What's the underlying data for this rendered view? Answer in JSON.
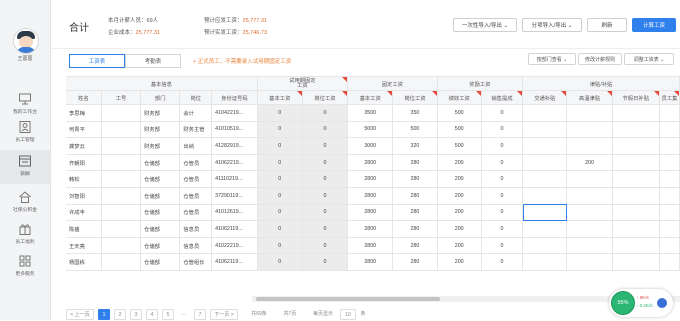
{
  "sidebar": {
    "user_name": "王蓉蓉",
    "items": [
      {
        "label": "我的工作台",
        "icon": "monitor-icon"
      },
      {
        "label": "员工管理",
        "icon": "employee-icon"
      },
      {
        "label": "薪酬",
        "icon": "payroll-icon"
      },
      {
        "label": "社保公积金",
        "icon": "house-icon"
      },
      {
        "label": "员工福利",
        "icon": "gift-icon"
      },
      {
        "label": "更多服务",
        "icon": "grid-icon"
      }
    ]
  },
  "header": {
    "title": "合计",
    "stats": {
      "count_label": "本月计薪人员：",
      "count_value": "69人",
      "cost_label": "企业成本：",
      "cost_value": "25,777.31",
      "plan_label": "预计应发工资：",
      "plan_value": "25,777.31",
      "actual_label": "预计实发工资：",
      "actual_value": "25,746.73"
    },
    "buttons": {
      "import_export": "一次性导入/导出 ⌄",
      "split_import": "分项导入/导出 ⌄",
      "refresh": "刷新",
      "calculate": "计算工资"
    }
  },
  "tabs": {
    "salary": "工资表",
    "attendance": "考勤表"
  },
  "hint": "+ 正式员工，不需要录入试用期固定工资",
  "toolbar": {
    "by_dept": "按部门查看 ⌄",
    "modify_rules": "修改计薪规则",
    "adjust_table": "调整工资表 ⌄"
  },
  "table": {
    "groups": {
      "basic": "基本信息",
      "trial": "试用期固定\n工资",
      "fixed": "固定工资",
      "bonus": "奖励工资",
      "allowance": "津贴/补贴"
    },
    "columns": [
      "姓名",
      "工号",
      "部门",
      "岗位",
      "身份证号码",
      "基本工资",
      "岗位工资",
      "基本工资",
      "岗位工资",
      "绩效工资",
      "销售提成",
      "交通补贴",
      "高温津贴",
      "节假日补贴",
      "员工集"
    ],
    "rows": [
      [
        "李思梅",
        "",
        "财务部",
        "会计",
        "41042219...",
        "0",
        "0",
        "3500",
        "350",
        "500",
        "0",
        "",
        "",
        "",
        ""
      ],
      [
        "何青平",
        "",
        "财务部",
        "财务主管",
        "41010519...",
        "0",
        "0",
        "5000",
        "500",
        "500",
        "0",
        "",
        "",
        "",
        ""
      ],
      [
        "龚梦云",
        "",
        "财务部",
        "出纳",
        "41282919...",
        "0",
        "0",
        "3000",
        "320",
        "500",
        "0",
        "",
        "",
        "",
        ""
      ],
      [
        "齐朝阳",
        "",
        "仓储部",
        "仓管员",
        "41062219...",
        "0",
        "0",
        "2800",
        "280",
        "200",
        "0",
        "",
        "200",
        "",
        ""
      ],
      [
        "韩松",
        "",
        "仓储部",
        "仓管员",
        "41110219...",
        "0",
        "0",
        "2800",
        "280",
        "200",
        "0",
        "",
        "",
        "",
        ""
      ],
      [
        "刘智阳",
        "",
        "仓储部",
        "仓管员",
        "37290119...",
        "0",
        "0",
        "2800",
        "280",
        "200",
        "0",
        "",
        "",
        "",
        ""
      ],
      [
        "许成丰",
        "",
        "仓储部",
        "仓管员",
        "41012619...",
        "0",
        "0",
        "2800",
        "280",
        "200",
        "0",
        "",
        "",
        "",
        ""
      ],
      [
        "陈盛",
        "",
        "仓储部",
        "信息员",
        "41062119...",
        "0",
        "0",
        "2800",
        "280",
        "200",
        "0",
        "",
        "",
        "",
        ""
      ],
      [
        "王天亮",
        "",
        "仓储部",
        "信息员",
        "41022219...",
        "0",
        "0",
        "2800",
        "280",
        "200",
        "0",
        "",
        "",
        "",
        ""
      ],
      [
        "杨国栋",
        "",
        "仓储部",
        "仓管组长",
        "41062119...",
        "0",
        "0",
        "2800",
        "280",
        "200",
        "0",
        "",
        "",
        "",
        ""
      ]
    ]
  },
  "pager": {
    "prev": "< 上一页",
    "pages": [
      "1",
      "2",
      "3",
      "4",
      "5",
      "...",
      "7"
    ],
    "next": "下一页 >",
    "total": "共69条",
    "pages_total": "共7页",
    "per_page": "每页显示",
    "size": "10",
    "size2": "条"
  },
  "widget": {
    "percent": "55%",
    "up": "↑ 8K/s",
    "down": "↓ 0.2K/s"
  },
  "colors": {
    "accent": "#2f80ed",
    "highlight": "#e06a2c",
    "flag": "#e64a3b"
  }
}
